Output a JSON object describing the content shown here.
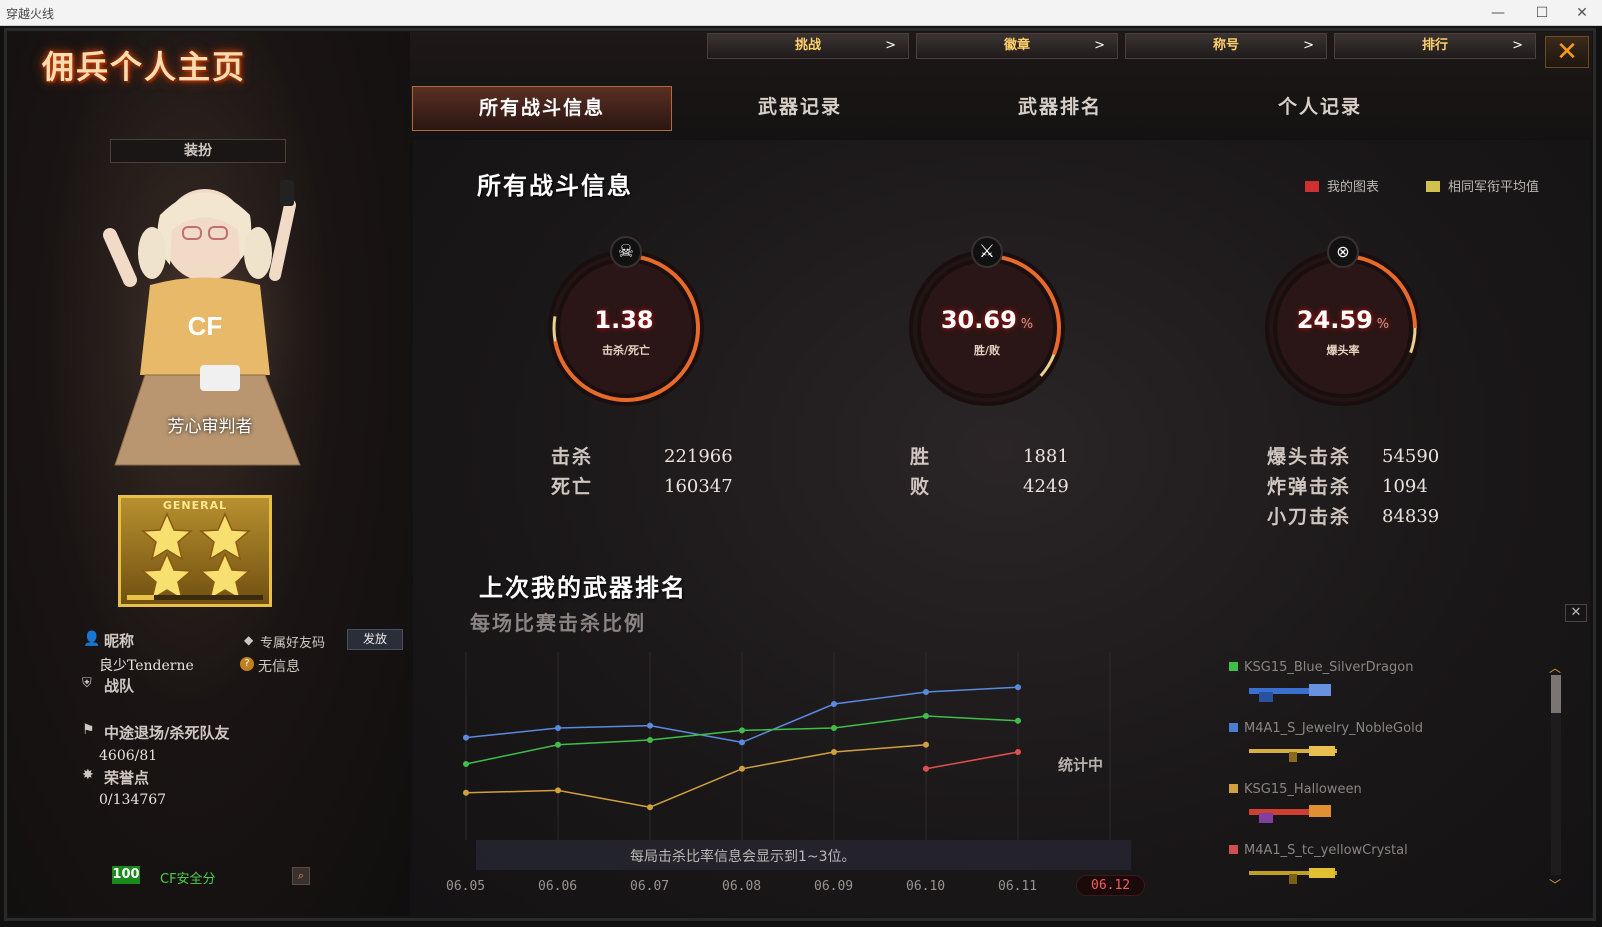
{
  "window": {
    "title": "穿越火线",
    "minimize": "—",
    "maximize": "☐",
    "close": "✕"
  },
  "page_title": "佣兵个人主页",
  "top_tabs": [
    {
      "label": "挑战",
      "arrow": ">"
    },
    {
      "label": "徽章",
      "arrow": ">"
    },
    {
      "label": "称号",
      "arrow": ">"
    },
    {
      "label": "排行",
      "arrow": ">"
    }
  ],
  "close_button": "✕",
  "tabs": [
    {
      "label": "所有战斗信息"
    },
    {
      "label": "武器记录"
    },
    {
      "label": "武器排名"
    },
    {
      "label": "个人记录"
    }
  ],
  "left": {
    "dress_button": "装扮",
    "title_overlay": "芳心审判者",
    "rank_badge": "GENERAL",
    "nickname_label": "昵称",
    "nickname_value": "良少Tenderne",
    "friend_code_label": "专属好友码",
    "send_button": "发放",
    "no_info": "无信息",
    "clan_label": "战队",
    "quit_label": "中途退场/杀死队友",
    "quit_value": "4606/81",
    "honor_label": "荣誉点",
    "honor_value": "0/134767",
    "security_score": "100",
    "security_label": "CF安全分"
  },
  "battle": {
    "title": "所有战斗信息",
    "legend_mine": "我的图表",
    "legend_avg": "相同军衔平均值",
    "kd": {
      "value": "1.38",
      "label": "击杀/死亡",
      "pct": ""
    },
    "win": {
      "value": "30.69",
      "label": "胜/败",
      "pct": "%"
    },
    "hs": {
      "value": "24.59",
      "label": "爆头率",
      "pct": "%"
    },
    "kills_label": "击杀",
    "kills": "221966",
    "deaths_label": "死亡",
    "deaths": "160347",
    "wins_label": "胜",
    "wins": "1881",
    "losses_label": "败",
    "losses": "4249",
    "hs_kills_label": "爆头击杀",
    "hs_kills": "54590",
    "bomb_kills_label": "炸弹击杀",
    "bomb_kills": "1094",
    "knife_kills_label": "小刀击杀",
    "knife_kills": "84839"
  },
  "weapon_rank": {
    "title": "上次我的武器排名",
    "subtitle": "每场比赛击杀比例",
    "status": "统计中",
    "note": "每局击杀比率信息会显示到1~3位。",
    "weapons": [
      {
        "name": "KSG15_Blue_SilverDragon",
        "color": "#3fbf4a"
      },
      {
        "name": "M4A1_S_Jewelry_NobleGold",
        "color": "#4a7fd0"
      },
      {
        "name": "KSG15_Halloween",
        "color": "#d0a040"
      },
      {
        "name": "M4A1_S_tc_yellowCrystal",
        "color": "#d05050"
      }
    ]
  },
  "chart_data": {
    "type": "line",
    "categories": [
      "06.05",
      "06.06",
      "06.07",
      "06.08",
      "06.09",
      "06.10",
      "06.11",
      "06.12"
    ],
    "selected": "06.12",
    "ylim": [
      0,
      1
    ],
    "series": [
      {
        "color": "#5a8ae0",
        "values": [
          0.62,
          0.7,
          0.72,
          0.58,
          0.9,
          1.0,
          1.04,
          null
        ]
      },
      {
        "color": "#3fbf4a",
        "values": [
          0.4,
          0.56,
          0.6,
          0.68,
          0.7,
          0.8,
          0.76,
          null
        ]
      },
      {
        "color": "#d0a040",
        "values": [
          0.16,
          0.18,
          0.04,
          0.36,
          0.5,
          0.56,
          null,
          null
        ]
      },
      {
        "color": "#e05050",
        "values": [
          null,
          null,
          null,
          null,
          null,
          0.36,
          0.5,
          null
        ]
      }
    ]
  }
}
